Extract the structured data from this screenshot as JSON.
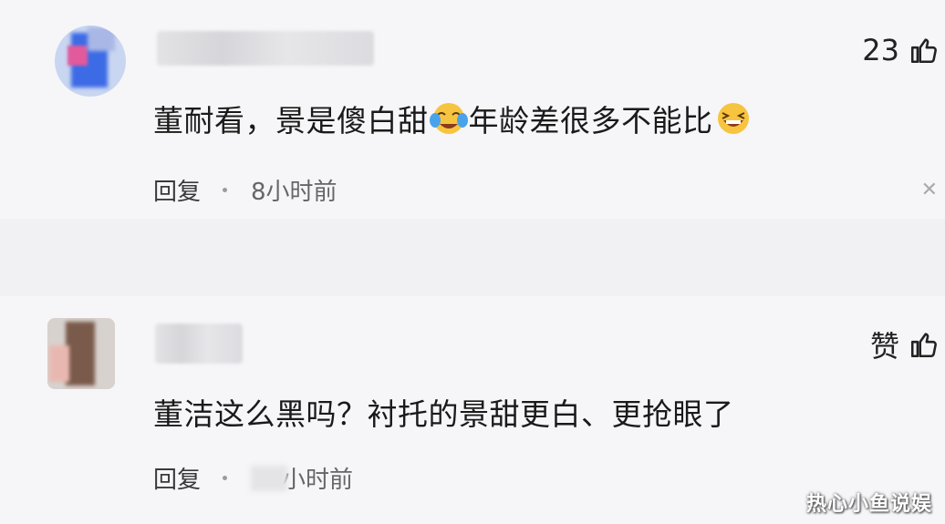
{
  "comments": [
    {
      "text_a": "董耐看，景是傻白甜",
      "text_b": "年龄差很多不能比",
      "reply_label": "回复",
      "time": "8小时前",
      "like": "23",
      "emoji_1": "crying-laughing-face-icon",
      "emoji_2": "laughing-face-icon"
    },
    {
      "text": "董洁这么黑吗？衬托的景甜更白、更抢眼了",
      "reply_label": "回复",
      "time": "小时前",
      "like": "赞"
    }
  ],
  "watermark": "热心小鱼说娱"
}
